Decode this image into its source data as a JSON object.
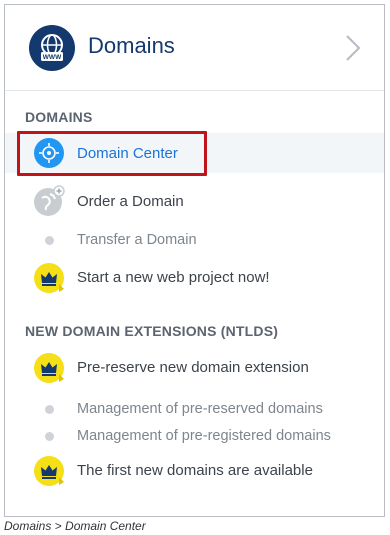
{
  "header": {
    "title": "Domains",
    "icon": "globe-www-icon",
    "chevron": "chevron-right-icon"
  },
  "sections": [
    {
      "title": "DOMAINS",
      "items": [
        {
          "label": "Domain Center",
          "icon": "globe-compass-icon",
          "active": true
        },
        {
          "label": "Order a Domain",
          "icon": "globe-add-icon"
        },
        {
          "label": "Transfer a Domain",
          "icon": "bullet"
        },
        {
          "label": "Start a new web project now!",
          "icon": "crown-icon"
        }
      ]
    },
    {
      "title": "NEW DOMAIN EXTENSIONS (NTLDS)",
      "items": [
        {
          "label": "Pre-reserve new domain extension",
          "icon": "crown-icon"
        },
        {
          "label": "Management of pre-reserved domains",
          "icon": "bullet"
        },
        {
          "label": "Management of pre-registered domains",
          "icon": "bullet"
        },
        {
          "label": "The first new domains are available",
          "icon": "crown-icon"
        }
      ]
    }
  ],
  "caption": "Domains > Domain Center",
  "colors": {
    "brand": "#13396e",
    "link": "#1a73d9",
    "highlight": "#c0141b",
    "crown_badge": "#f5df16"
  }
}
